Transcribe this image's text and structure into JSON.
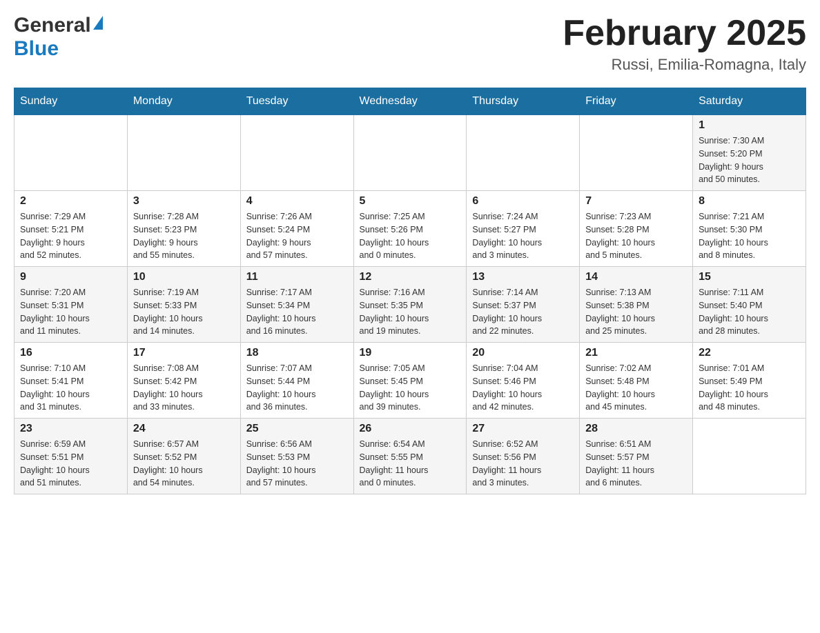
{
  "header": {
    "logo_general": "General",
    "logo_blue": "Blue",
    "month_title": "February 2025",
    "location": "Russi, Emilia-Romagna, Italy"
  },
  "calendar": {
    "days_of_week": [
      "Sunday",
      "Monday",
      "Tuesday",
      "Wednesday",
      "Thursday",
      "Friday",
      "Saturday"
    ],
    "weeks": [
      [
        {
          "day": "",
          "info": ""
        },
        {
          "day": "",
          "info": ""
        },
        {
          "day": "",
          "info": ""
        },
        {
          "day": "",
          "info": ""
        },
        {
          "day": "",
          "info": ""
        },
        {
          "day": "",
          "info": ""
        },
        {
          "day": "1",
          "info": "Sunrise: 7:30 AM\nSunset: 5:20 PM\nDaylight: 9 hours\nand 50 minutes."
        }
      ],
      [
        {
          "day": "2",
          "info": "Sunrise: 7:29 AM\nSunset: 5:21 PM\nDaylight: 9 hours\nand 52 minutes."
        },
        {
          "day": "3",
          "info": "Sunrise: 7:28 AM\nSunset: 5:23 PM\nDaylight: 9 hours\nand 55 minutes."
        },
        {
          "day": "4",
          "info": "Sunrise: 7:26 AM\nSunset: 5:24 PM\nDaylight: 9 hours\nand 57 minutes."
        },
        {
          "day": "5",
          "info": "Sunrise: 7:25 AM\nSunset: 5:26 PM\nDaylight: 10 hours\nand 0 minutes."
        },
        {
          "day": "6",
          "info": "Sunrise: 7:24 AM\nSunset: 5:27 PM\nDaylight: 10 hours\nand 3 minutes."
        },
        {
          "day": "7",
          "info": "Sunrise: 7:23 AM\nSunset: 5:28 PM\nDaylight: 10 hours\nand 5 minutes."
        },
        {
          "day": "8",
          "info": "Sunrise: 7:21 AM\nSunset: 5:30 PM\nDaylight: 10 hours\nand 8 minutes."
        }
      ],
      [
        {
          "day": "9",
          "info": "Sunrise: 7:20 AM\nSunset: 5:31 PM\nDaylight: 10 hours\nand 11 minutes."
        },
        {
          "day": "10",
          "info": "Sunrise: 7:19 AM\nSunset: 5:33 PM\nDaylight: 10 hours\nand 14 minutes."
        },
        {
          "day": "11",
          "info": "Sunrise: 7:17 AM\nSunset: 5:34 PM\nDaylight: 10 hours\nand 16 minutes."
        },
        {
          "day": "12",
          "info": "Sunrise: 7:16 AM\nSunset: 5:35 PM\nDaylight: 10 hours\nand 19 minutes."
        },
        {
          "day": "13",
          "info": "Sunrise: 7:14 AM\nSunset: 5:37 PM\nDaylight: 10 hours\nand 22 minutes."
        },
        {
          "day": "14",
          "info": "Sunrise: 7:13 AM\nSunset: 5:38 PM\nDaylight: 10 hours\nand 25 minutes."
        },
        {
          "day": "15",
          "info": "Sunrise: 7:11 AM\nSunset: 5:40 PM\nDaylight: 10 hours\nand 28 minutes."
        }
      ],
      [
        {
          "day": "16",
          "info": "Sunrise: 7:10 AM\nSunset: 5:41 PM\nDaylight: 10 hours\nand 31 minutes."
        },
        {
          "day": "17",
          "info": "Sunrise: 7:08 AM\nSunset: 5:42 PM\nDaylight: 10 hours\nand 33 minutes."
        },
        {
          "day": "18",
          "info": "Sunrise: 7:07 AM\nSunset: 5:44 PM\nDaylight: 10 hours\nand 36 minutes."
        },
        {
          "day": "19",
          "info": "Sunrise: 7:05 AM\nSunset: 5:45 PM\nDaylight: 10 hours\nand 39 minutes."
        },
        {
          "day": "20",
          "info": "Sunrise: 7:04 AM\nSunset: 5:46 PM\nDaylight: 10 hours\nand 42 minutes."
        },
        {
          "day": "21",
          "info": "Sunrise: 7:02 AM\nSunset: 5:48 PM\nDaylight: 10 hours\nand 45 minutes."
        },
        {
          "day": "22",
          "info": "Sunrise: 7:01 AM\nSunset: 5:49 PM\nDaylight: 10 hours\nand 48 minutes."
        }
      ],
      [
        {
          "day": "23",
          "info": "Sunrise: 6:59 AM\nSunset: 5:51 PM\nDaylight: 10 hours\nand 51 minutes."
        },
        {
          "day": "24",
          "info": "Sunrise: 6:57 AM\nSunset: 5:52 PM\nDaylight: 10 hours\nand 54 minutes."
        },
        {
          "day": "25",
          "info": "Sunrise: 6:56 AM\nSunset: 5:53 PM\nDaylight: 10 hours\nand 57 minutes."
        },
        {
          "day": "26",
          "info": "Sunrise: 6:54 AM\nSunset: 5:55 PM\nDaylight: 11 hours\nand 0 minutes."
        },
        {
          "day": "27",
          "info": "Sunrise: 6:52 AM\nSunset: 5:56 PM\nDaylight: 11 hours\nand 3 minutes."
        },
        {
          "day": "28",
          "info": "Sunrise: 6:51 AM\nSunset: 5:57 PM\nDaylight: 11 hours\nand 6 minutes."
        },
        {
          "day": "",
          "info": ""
        }
      ]
    ]
  }
}
